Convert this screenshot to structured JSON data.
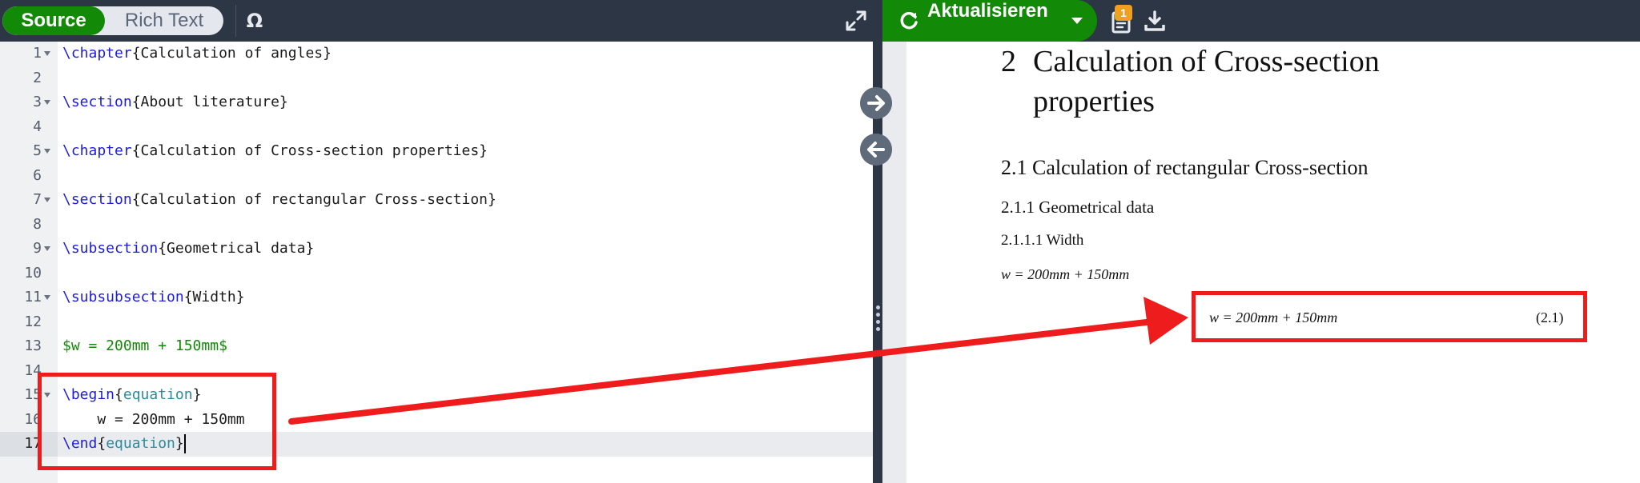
{
  "editor_toolbar": {
    "source_label": "Source",
    "rich_text_label": "Rich Text",
    "symbol_label": "Ω",
    "expand_icon": "expand-icon"
  },
  "code_lines": [
    {
      "n": "1",
      "fold": true,
      "parts": [
        {
          "t": "\\chapter",
          "c": "kw"
        },
        {
          "t": "{Calculation of angles}",
          "c": ""
        }
      ]
    },
    {
      "n": "2",
      "fold": false,
      "parts": []
    },
    {
      "n": "3",
      "fold": true,
      "parts": [
        {
          "t": "\\section",
          "c": "kw"
        },
        {
          "t": "{About literature}",
          "c": ""
        }
      ]
    },
    {
      "n": "4",
      "fold": false,
      "parts": []
    },
    {
      "n": "5",
      "fold": true,
      "parts": [
        {
          "t": "\\chapter",
          "c": "kw"
        },
        {
          "t": "{Calculation of Cross-section properties}",
          "c": ""
        }
      ]
    },
    {
      "n": "6",
      "fold": false,
      "parts": []
    },
    {
      "n": "7",
      "fold": true,
      "parts": [
        {
          "t": "\\section",
          "c": "kw"
        },
        {
          "t": "{Calculation of rectangular Cross-section}",
          "c": ""
        }
      ]
    },
    {
      "n": "8",
      "fold": false,
      "parts": []
    },
    {
      "n": "9",
      "fold": true,
      "parts": [
        {
          "t": "\\subsection",
          "c": "kw"
        },
        {
          "t": "{Geometrical data}",
          "c": ""
        }
      ]
    },
    {
      "n": "10",
      "fold": false,
      "parts": []
    },
    {
      "n": "11",
      "fold": true,
      "parts": [
        {
          "t": "\\subsubsection",
          "c": "kw"
        },
        {
          "t": "{Width}",
          "c": ""
        }
      ]
    },
    {
      "n": "12",
      "fold": false,
      "parts": []
    },
    {
      "n": "13",
      "fold": false,
      "parts": [
        {
          "t": "$w = 200mm + 150mm$",
          "c": "math"
        }
      ]
    },
    {
      "n": "14",
      "fold": false,
      "parts": []
    },
    {
      "n": "15",
      "fold": true,
      "parts": [
        {
          "t": "\\begin",
          "c": "kw"
        },
        {
          "t": "{",
          "c": ""
        },
        {
          "t": "equation",
          "c": "env"
        },
        {
          "t": "}",
          "c": ""
        }
      ]
    },
    {
      "n": "16",
      "fold": false,
      "parts": [
        {
          "t": "    w = 200mm + 150mm",
          "c": ""
        }
      ]
    },
    {
      "n": "17",
      "fold": false,
      "active": true,
      "parts": [
        {
          "t": "\\end",
          "c": "kw"
        },
        {
          "t": "{",
          "c": ""
        },
        {
          "t": "equation",
          "c": "env"
        },
        {
          "t": "}",
          "c": ""
        }
      ]
    }
  ],
  "preview_toolbar": {
    "recompile_label": "Aktualisieren",
    "logs_badge": "1",
    "recompile_icon": "refresh-icon",
    "logs_icon": "logs-icon",
    "download_icon": "download-icon"
  },
  "pdf": {
    "chapter_number": "2",
    "chapter_title": "Calculation of Cross-section properties",
    "section": "2.1  Calculation of rectangular Cross-section",
    "subsection": "2.1.1  Geometrical data",
    "subsubsection": "2.1.1.1  Width",
    "inline_equation": "w = 200mm + 150mm",
    "display_equation": "w = 200mm + 150mm",
    "equation_number": "(2.1)"
  },
  "colors": {
    "toolbar_bg": "#2c3645",
    "accent_green": "#138a07",
    "annotation_red": "#ee1c1c",
    "keyword_blue": "#1c1ce0",
    "environment_teal": "#2a8c9e"
  }
}
